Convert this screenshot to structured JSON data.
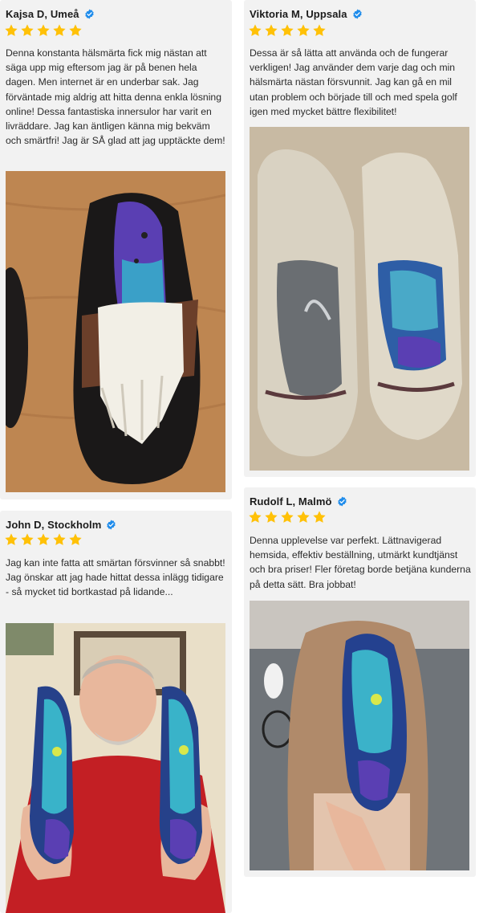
{
  "reviews": [
    {
      "name": "Kajsa D, Umeå",
      "rating": 5,
      "text": "Denna konstanta hälsmärta fick mig nästan att säga upp mig eftersom jag är på benen hela dagen. Men internet är en underbar sak. Jag förväntade mig aldrig att hitta denna enkla lösning online! Dessa fantastiska innersulor har varit en livräddare. Jag kan äntligen känna mig bekväm och smärtfri! Jag är SÅ glad att jag upptäckte dem!"
    },
    {
      "name": "Viktoria M, Uppsala",
      "rating": 5,
      "text": "Dessa är så lätta att använda och de fungerar verkligen! Jag använder dem varje dag och min hälsmärta nästan försvunnit. Jag kan gå en mil utan problem och började till och med spela golf igen med mycket bättre flexibilitet!"
    },
    {
      "name": "John D, Stockholm",
      "rating": 5,
      "text": "Jag kan inte fatta att smärtan försvinner så snabbt! Jag önskar att jag hade hittat dessa inlägg tidigare - så mycket tid bortkastad på lidande..."
    },
    {
      "name": "Rudolf L, Malmö",
      "rating": 5,
      "text": "Denna upplevelse var perfekt. Lättnavigerad hemsida, effektiv beställning, utmärkt kundtjänst och bra priser! Fler företag borde betjäna kunderna på detta sätt. Bra jobbat!"
    }
  ],
  "colors": {
    "star": "#ffc107",
    "verified": "#1f8ceb",
    "card_bg": "#f2f2f2"
  },
  "icons": {
    "rating": "star-icon",
    "badge": "verified-check-icon"
  }
}
